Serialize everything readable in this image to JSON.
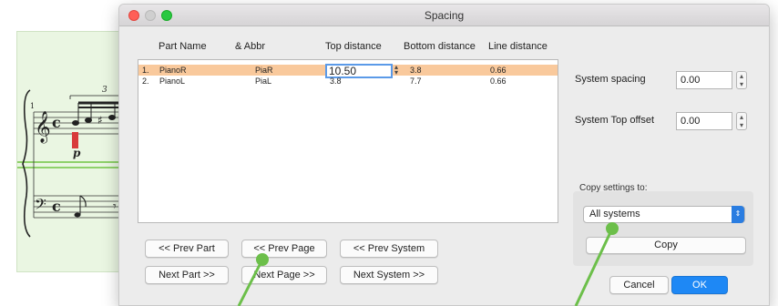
{
  "score": {
    "tuplet_number": "3",
    "dynamic": "p"
  },
  "dialog": {
    "title": "Spacing"
  },
  "table": {
    "headers": {
      "part_name": "Part Name",
      "abbr": "& Abbr",
      "top_distance": "Top distance",
      "bottom_distance": "Bottom distance",
      "line_distance": "Line distance"
    },
    "rows": [
      {
        "index": "1.",
        "name": "PianoR",
        "abbr": "PiaR",
        "top": "10.50",
        "bottom": "3.8",
        "line": "0.66",
        "selected": true
      },
      {
        "index": "2.",
        "name": "PianoL",
        "abbr": "PiaL",
        "top": "3.8",
        "bottom": "7.7",
        "line": "0.66",
        "selected": false
      }
    ]
  },
  "nav_buttons": {
    "prev_part": "<< Prev Part",
    "prev_page": "<< Prev Page",
    "prev_system": "<< Prev System",
    "next_part": "Next Part >>",
    "next_page": "Next Page >>",
    "next_system": "Next System >>"
  },
  "system": {
    "spacing_label": "System spacing",
    "spacing_value": "0.00",
    "top_offset_label": "System Top offset",
    "top_offset_value": "0.00"
  },
  "copy_settings": {
    "label": "Copy settings to:",
    "selected": "All systems",
    "copy_button": "Copy"
  },
  "footer": {
    "cancel": "Cancel",
    "ok": "OK"
  },
  "colors": {
    "selected_row": "#f9c99c",
    "accent": "#1e88f5",
    "annotation": "#6cbf4a",
    "score_highlight": "#8fd16a"
  }
}
